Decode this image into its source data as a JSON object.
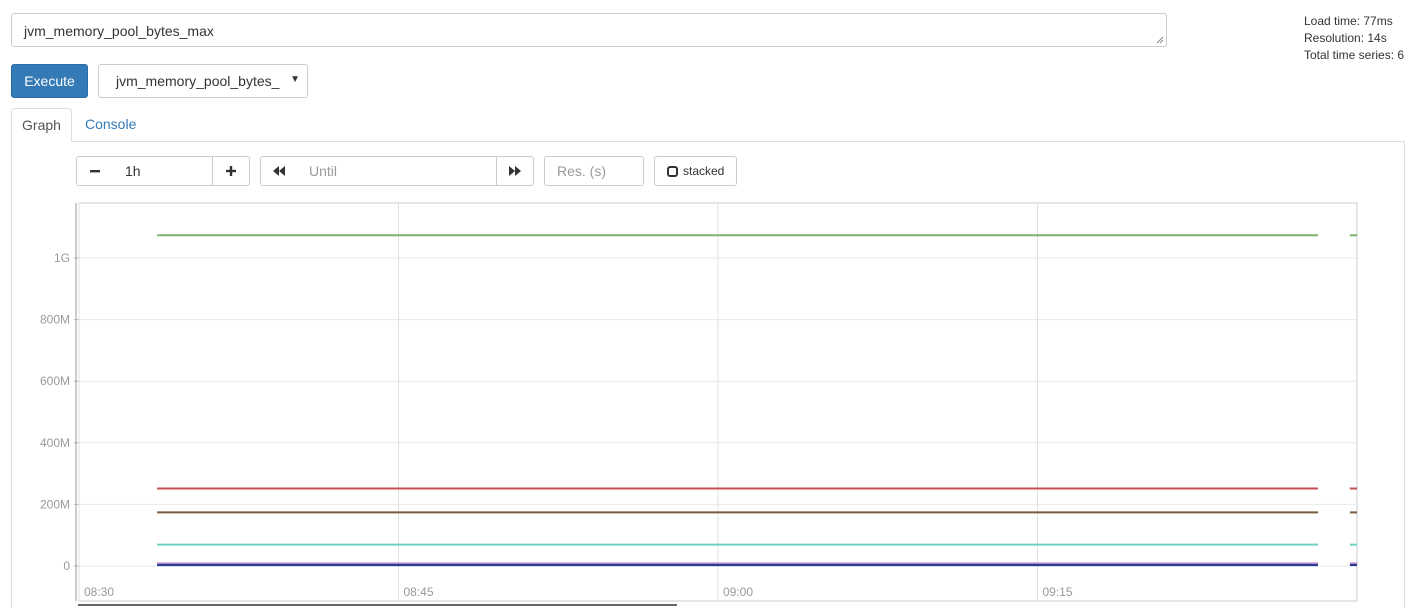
{
  "query": {
    "value": "jvm_memory_pool_bytes_max"
  },
  "stats": {
    "load_time": "Load time: 77ms",
    "resolution": "Resolution: 14s",
    "total_series": "Total time series: 6"
  },
  "toolbar": {
    "execute_label": "Execute",
    "metric_select_value": "jvm_memory_pool_bytes_"
  },
  "tabs": [
    {
      "label": "Graph",
      "active": true
    },
    {
      "label": "Console",
      "active": false
    }
  ],
  "graph_controls": {
    "range_value": "1h",
    "until_placeholder": "Until",
    "resolution_placeholder": "Res. (s)",
    "stacked_label": "stacked",
    "icons": [
      "minus-icon",
      "plus-icon",
      "backward-icon",
      "forward-icon"
    ]
  },
  "chart_data": {
    "type": "line",
    "x_ticks": [
      "08:30",
      "08:45",
      "09:00",
      "09:15"
    ],
    "y_ticks": [
      "0",
      "200M",
      "400M",
      "600M",
      "800M",
      "1G"
    ],
    "y_tick_values": [
      0,
      200000000,
      400000000,
      600000000,
      800000000,
      1000000000
    ],
    "xlim": [
      "08:30",
      "09:30"
    ],
    "ylim": [
      0,
      1180000000
    ],
    "grid": true,
    "series": [
      {
        "color": "#7eb26d",
        "start": "08:33:40",
        "end": "09:28:10",
        "resume": "09:29:40",
        "value": 1073741824
      },
      {
        "color": "#c44e52",
        "start": "08:33:40",
        "end": "09:28:10",
        "resume": "09:29:40",
        "value": 251658240
      },
      {
        "color": "#7a5c3c",
        "start": "08:33:40",
        "end": "09:28:10",
        "resume": "09:29:40",
        "value": 174063616
      },
      {
        "color": "#6ed0c0",
        "start": "08:33:40",
        "end": "09:28:10",
        "resume": "09:29:40",
        "value": 69206016
      },
      {
        "color": "#b07ec3",
        "start": "08:33:40",
        "end": "09:28:10",
        "resume": "09:29:40",
        "value": 8000000
      },
      {
        "color": "#1f3a93",
        "start": "08:33:40",
        "end": "09:28:10",
        "resume": "09:29:40",
        "value": 3000000
      }
    ]
  }
}
